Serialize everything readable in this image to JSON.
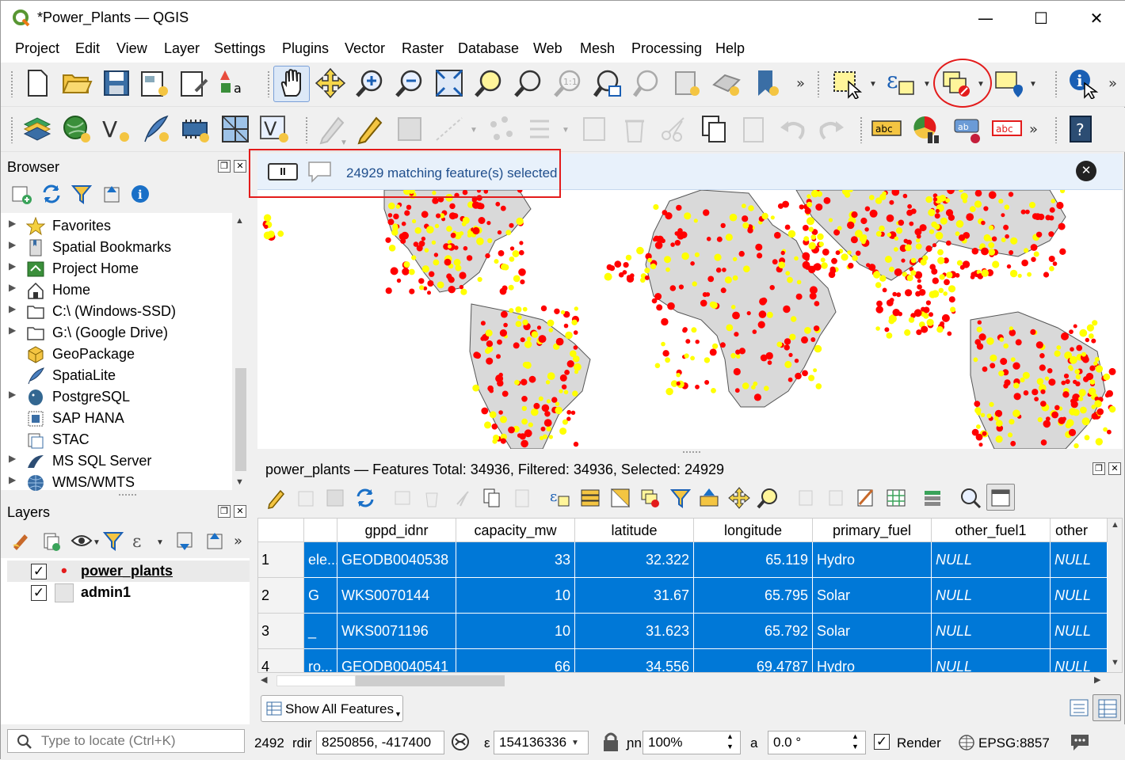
{
  "window": {
    "title": "*Power_Plants — QGIS",
    "minimize": "—",
    "maximize": "☐",
    "close": "✕"
  },
  "menu": [
    "Project",
    "Edit",
    "View",
    "Layer",
    "Settings",
    "Plugins",
    "Vector",
    "Raster",
    "Database",
    "Web",
    "Mesh",
    "Processing",
    "Help"
  ],
  "browser": {
    "title": "Browser",
    "items": [
      {
        "label": "Favorites",
        "expand": true,
        "icon": "star-icon"
      },
      {
        "label": "Spatial Bookmarks",
        "expand": true,
        "icon": "bookmark-icon"
      },
      {
        "label": "Project Home",
        "expand": true,
        "icon": "project-home-icon"
      },
      {
        "label": "Home",
        "expand": true,
        "icon": "home-icon"
      },
      {
        "label": "C:\\ (Windows-SSD)",
        "expand": true,
        "icon": "folder-icon"
      },
      {
        "label": "G:\\ (Google Drive)",
        "expand": true,
        "icon": "folder-icon"
      },
      {
        "label": "GeoPackage",
        "expand": false,
        "icon": "geopackage-icon"
      },
      {
        "label": "SpatiaLite",
        "expand": false,
        "icon": "spatialite-icon"
      },
      {
        "label": "PostgreSQL",
        "expand": true,
        "icon": "postgresql-icon"
      },
      {
        "label": "SAP HANA",
        "expand": false,
        "icon": "sap-hana-icon"
      },
      {
        "label": "STAC",
        "expand": false,
        "icon": "stac-icon"
      },
      {
        "label": "MS SQL Server",
        "expand": true,
        "icon": "mssql-icon"
      },
      {
        "label": "WMS/WMTS",
        "expand": true,
        "icon": "wms-icon"
      }
    ]
  },
  "layers": {
    "title": "Layers",
    "items": [
      {
        "label": "power_plants",
        "checked": true,
        "symbol": "•"
      },
      {
        "label": "admin1",
        "checked": true,
        "symbol": ""
      }
    ]
  },
  "message_bar": {
    "text": "24929 matching feature(s) selected",
    "pause": "II",
    "close": "✕"
  },
  "attribute_table": {
    "title": "power_plants — Features Total: 34936, Filtered: 34936, Selected: 24929",
    "columns": [
      "",
      "gppd_idnr",
      "capacity_mw",
      "latitude",
      "longitude",
      "primary_fuel",
      "other_fuel1",
      "other"
    ],
    "rows": [
      {
        "n": "1",
        "c0": "ele...",
        "c1": "GEODB0040538",
        "c2": "33",
        "c3": "32.322",
        "c4": "65.119",
        "c5": "Hydro",
        "c6": "NULL",
        "c7": "NULL"
      },
      {
        "n": "2",
        "c0": "G",
        "c1": "WKS0070144",
        "c2": "10",
        "c3": "31.67",
        "c4": "65.795",
        "c5": "Solar",
        "c6": "NULL",
        "c7": "NULL"
      },
      {
        "n": "3",
        "c0": "_",
        "c1": "WKS0071196",
        "c2": "10",
        "c3": "31.623",
        "c4": "65.792",
        "c5": "Solar",
        "c6": "NULL",
        "c7": "NULL"
      },
      {
        "n": "4",
        "c0": "ro...",
        "c1": "GEODB0040541",
        "c2": "66",
        "c3": "34.556",
        "c4": "69.4787",
        "c5": "Hydro",
        "c6": "NULL",
        "c7": "NULL"
      }
    ],
    "show_all": "Show All Features"
  },
  "status": {
    "locator_placeholder": "Type to locate (Ctrl+K)",
    "msg_count": "2492",
    "coord_label": "rdir",
    "coordinate": "8250856, -417400",
    "scale_label": "ε",
    "scale": "154136336",
    "mag_label": "ɲn",
    "magnifier": "100%",
    "rot_label": "a",
    "rotation": "0.0 °",
    "render": "Render",
    "crs": "EPSG:8857"
  },
  "colors": {
    "selection": "#0078d7",
    "point_selected": "#ffff00",
    "point": "#ff0000",
    "country": "#d9d9d9",
    "highlight": "#e31b1b"
  }
}
